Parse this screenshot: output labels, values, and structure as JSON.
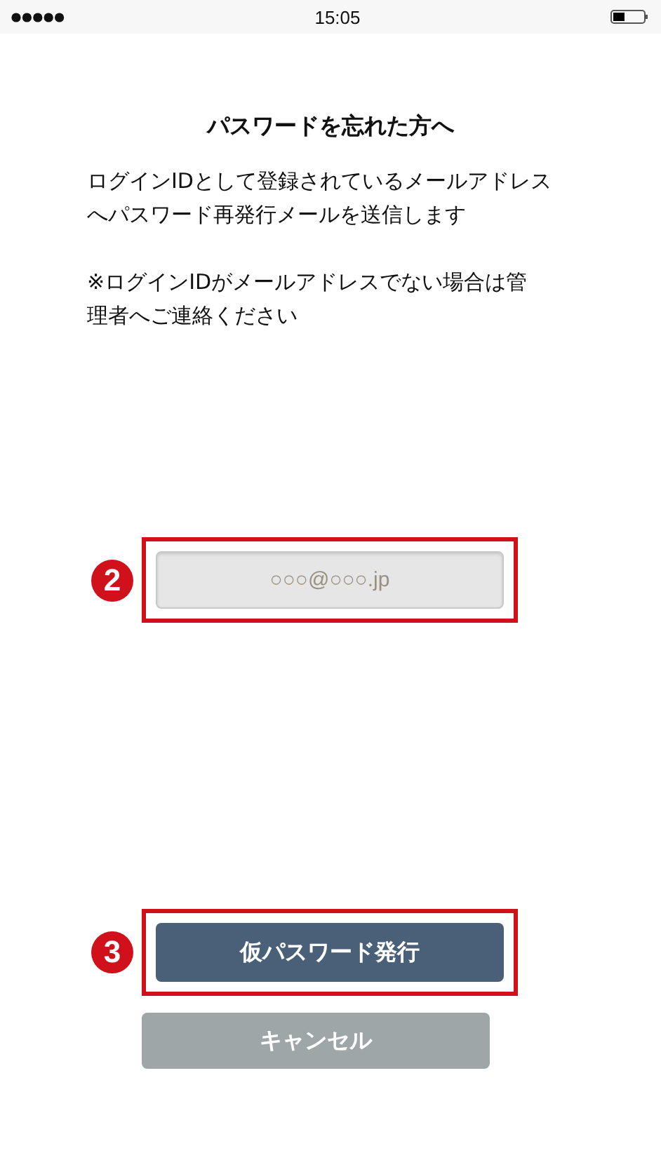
{
  "status_bar": {
    "time": "15:05"
  },
  "title": "パスワードを忘れた方へ",
  "paragraphs": [
    [
      "ログインIDとして登録されているメールアドレス",
      "へパスワード再発行メールを送信します"
    ],
    [
      "※ログインIDがメールアドレスでない場合は管",
      "理者へご連絡ください"
    ]
  ],
  "email_field": {
    "placeholder": "○○○@○○○.jp",
    "callout": "2"
  },
  "buttons": [
    {
      "kind": "primary",
      "label": "仮パスワード発行",
      "callout": "3"
    },
    {
      "kind": "secondary",
      "label": "キャンセル"
    }
  ]
}
